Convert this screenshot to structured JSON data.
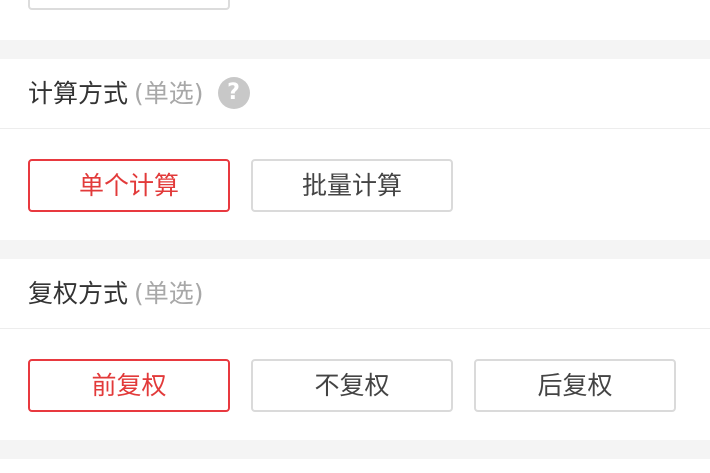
{
  "calc_section": {
    "title": "计算方式",
    "subtitle": "(单选)",
    "help_icon": "?",
    "options": [
      "单个计算",
      "批量计算"
    ],
    "selected": "单个计算"
  },
  "adjust_section": {
    "title": "复权方式",
    "subtitle": "(单选)",
    "options": [
      "前复权",
      "不复权",
      "后复权"
    ],
    "selected": "前复权"
  },
  "colors": {
    "accent": "#e8393f",
    "divider_band": "#f4f4f4",
    "subtitle": "#a8a8a8"
  }
}
